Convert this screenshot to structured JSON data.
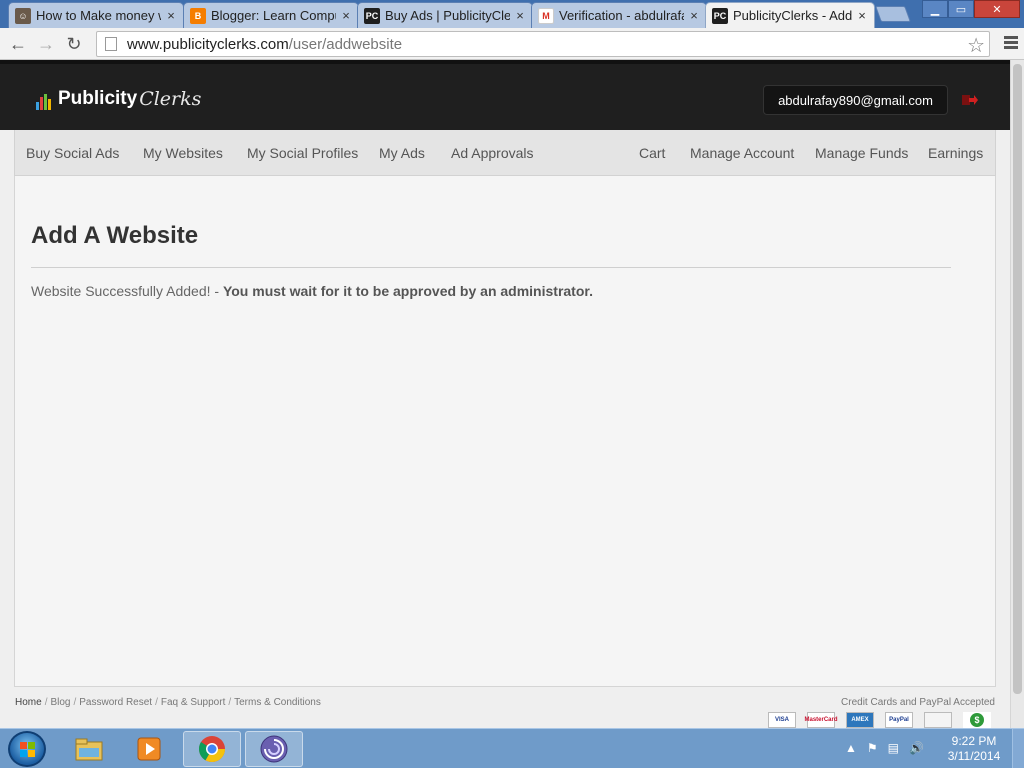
{
  "browser": {
    "tabs": [
      {
        "title": "How to Make money w",
        "favicon": "person-avatar-icon",
        "favicon_color": "#6a5a4a"
      },
      {
        "title": "Blogger: Learn Compu",
        "favicon": "blogger-icon",
        "favicon_color": "#f57d00"
      },
      {
        "title": "Buy Ads | PublicityCle",
        "favicon": "pc-icon",
        "favicon_color": "#1f1f1f"
      },
      {
        "title": "Verification - abdulrafa",
        "favicon": "gmail-icon",
        "favicon_color": "#d93025"
      },
      {
        "title": "PublicityClerks - Add A",
        "favicon": "pc-icon",
        "favicon_color": "#1f1f1f",
        "active": true
      }
    ],
    "favicon_text": {
      "pc": "PC",
      "blogger": "B",
      "gmail": "M"
    },
    "close_glyph": "×",
    "url_host": "www.publicityclerks.com",
    "url_path": "/user/addwebsite",
    "window_controls": {
      "minimize": "▁",
      "maximize": "▭",
      "close": "✕"
    }
  },
  "site": {
    "logo_word1": "Publicity",
    "logo_word2": "Clerks",
    "user_email": "abdulrafay890@gmail.com",
    "nav_left": [
      "Buy Social Ads",
      "My Websites",
      "My Social Profiles",
      "My Ads",
      "Ad Approvals"
    ],
    "nav_right": [
      "Cart",
      "Manage Account",
      "Manage Funds",
      "Earnings"
    ],
    "page_title": "Add A Website",
    "message_plain": "Website Successfully Added! - ",
    "message_bold": "You must wait for it to be approved by an administrator.",
    "footer_links": [
      "Home",
      "Blog",
      "Password Reset",
      "Faq & Support",
      "Terms & Conditions"
    ],
    "footer_sep": "/",
    "payment_note": "Credit Cards and PayPal Accepted",
    "payment_cards": [
      {
        "name": "visa-icon",
        "label": "VISA",
        "color": "#1a3b8f"
      },
      {
        "name": "mastercard-icon",
        "label": "MasterCard",
        "color": "#c8102e"
      },
      {
        "name": "amex-icon",
        "label": "AMEX",
        "color": "#2e77bc"
      },
      {
        "name": "paypal-icon",
        "label": "PayPal",
        "color": "#1a3b8f"
      },
      {
        "name": "card-generic-icon",
        "label": "",
        "color": "#999999"
      },
      {
        "name": "dollar-icon",
        "label": "$",
        "color": "#2e9a3a"
      }
    ]
  },
  "taskbar": {
    "apps": [
      "explorer-icon",
      "media-player-icon",
      "chrome-icon",
      "app-swirl-icon"
    ],
    "clock_time": "9:22 PM",
    "clock_date": "3/11/2014"
  },
  "colors": {
    "header_bg": "#1f1f1f",
    "nav_bg": "#e4e4e4",
    "taskbar_bg": "#6f9bc9"
  }
}
